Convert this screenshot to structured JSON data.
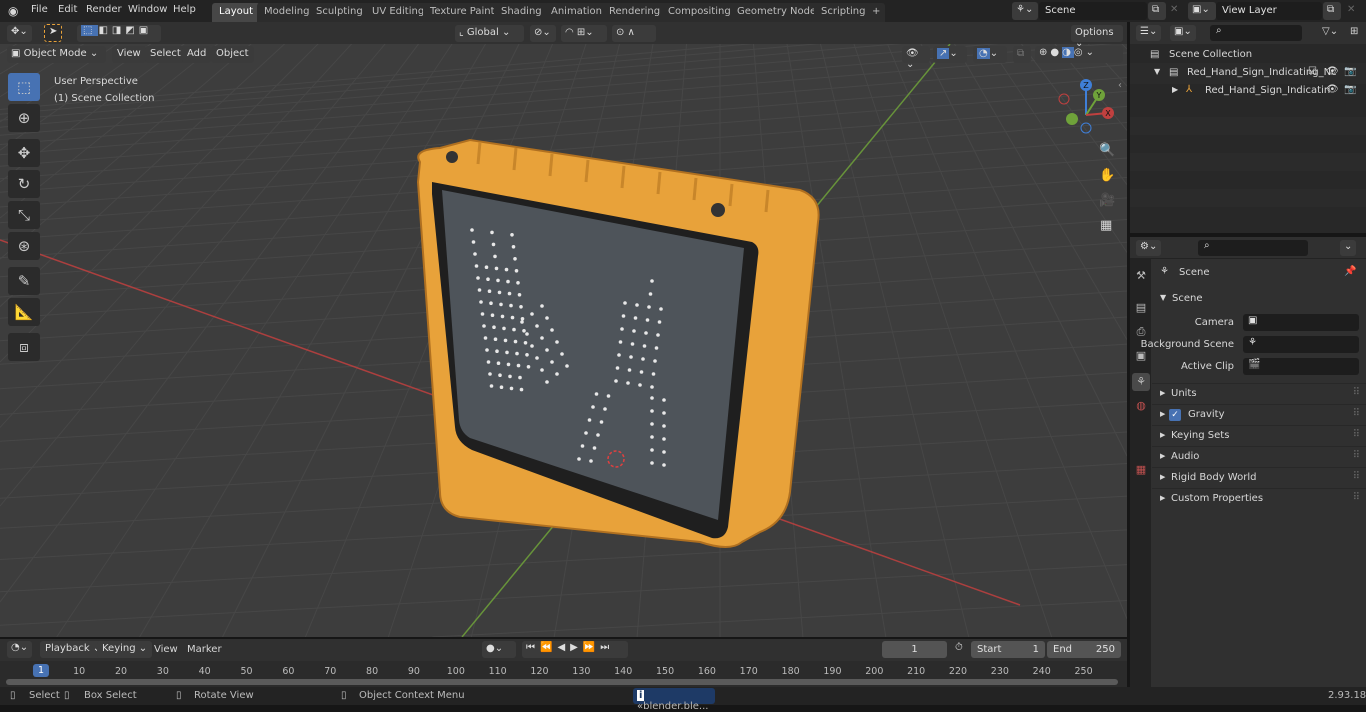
{
  "menu": [
    "File",
    "Edit",
    "Render",
    "Window",
    "Help"
  ],
  "workspaces": [
    "Layout",
    "Modeling",
    "Sculpting",
    "UV Editing",
    "Texture Paint",
    "Shading",
    "Animation",
    "Rendering",
    "Compositing",
    "Geometry Nodes",
    "Scripting"
  ],
  "active_workspace": "Layout",
  "scene_field": "Scene",
  "view_layer_field": "View Layer",
  "viewport": {
    "transform_orientation": "Global",
    "options_label": "Options",
    "mode": "Object Mode",
    "header_menus": [
      "View",
      "Select",
      "Add",
      "Object"
    ],
    "overlay_title": "User Perspective",
    "overlay_subtitle": "(1) Scene Collection",
    "gizmo_axes": [
      "Z",
      "Y",
      "X"
    ],
    "tools": [
      "select-box",
      "cursor",
      "move",
      "rotate",
      "scale",
      "transform",
      "annotate",
      "measure",
      "add-cube"
    ]
  },
  "outliner": {
    "root": "Scene Collection",
    "items": [
      {
        "label": "Red_Hand_Sign_Indicating_Nc",
        "type": "collection"
      },
      {
        "label": "Red_Hand_Sign_Indicatin",
        "type": "object"
      }
    ]
  },
  "properties": {
    "breadcrumb": "Scene",
    "section": "Scene",
    "fields": [
      {
        "label": "Camera",
        "value": ""
      },
      {
        "label": "Background Scene",
        "value": ""
      },
      {
        "label": "Active Clip",
        "value": ""
      }
    ],
    "panels": [
      "Units",
      "Gravity",
      "Keying Sets",
      "Audio",
      "Rigid Body World",
      "Custom Properties"
    ],
    "gravity_checked": true
  },
  "timeline": {
    "menus": [
      "Playback",
      "Keying",
      "View",
      "Marker"
    ],
    "current_frame": "1",
    "start_label": "Start",
    "start": "1",
    "end_label": "End",
    "end": "250",
    "ticks": [
      "1",
      "10",
      "20",
      "30",
      "40",
      "50",
      "60",
      "70",
      "80",
      "90",
      "100",
      "110",
      "120",
      "130",
      "140",
      "150",
      "160",
      "170",
      "180",
      "190",
      "200",
      "210",
      "220",
      "230",
      "240",
      "250"
    ]
  },
  "status": {
    "items": [
      "Select",
      "Box Select",
      "Rotate View",
      "Object Context Menu"
    ],
    "notification": "«blender.ble...",
    "version": "2.93.18"
  },
  "colors": {
    "accent": "#4772b3",
    "sign_orange": "#e8a23a",
    "x_axis": "#c0403f",
    "y_axis": "#6fa23a"
  }
}
